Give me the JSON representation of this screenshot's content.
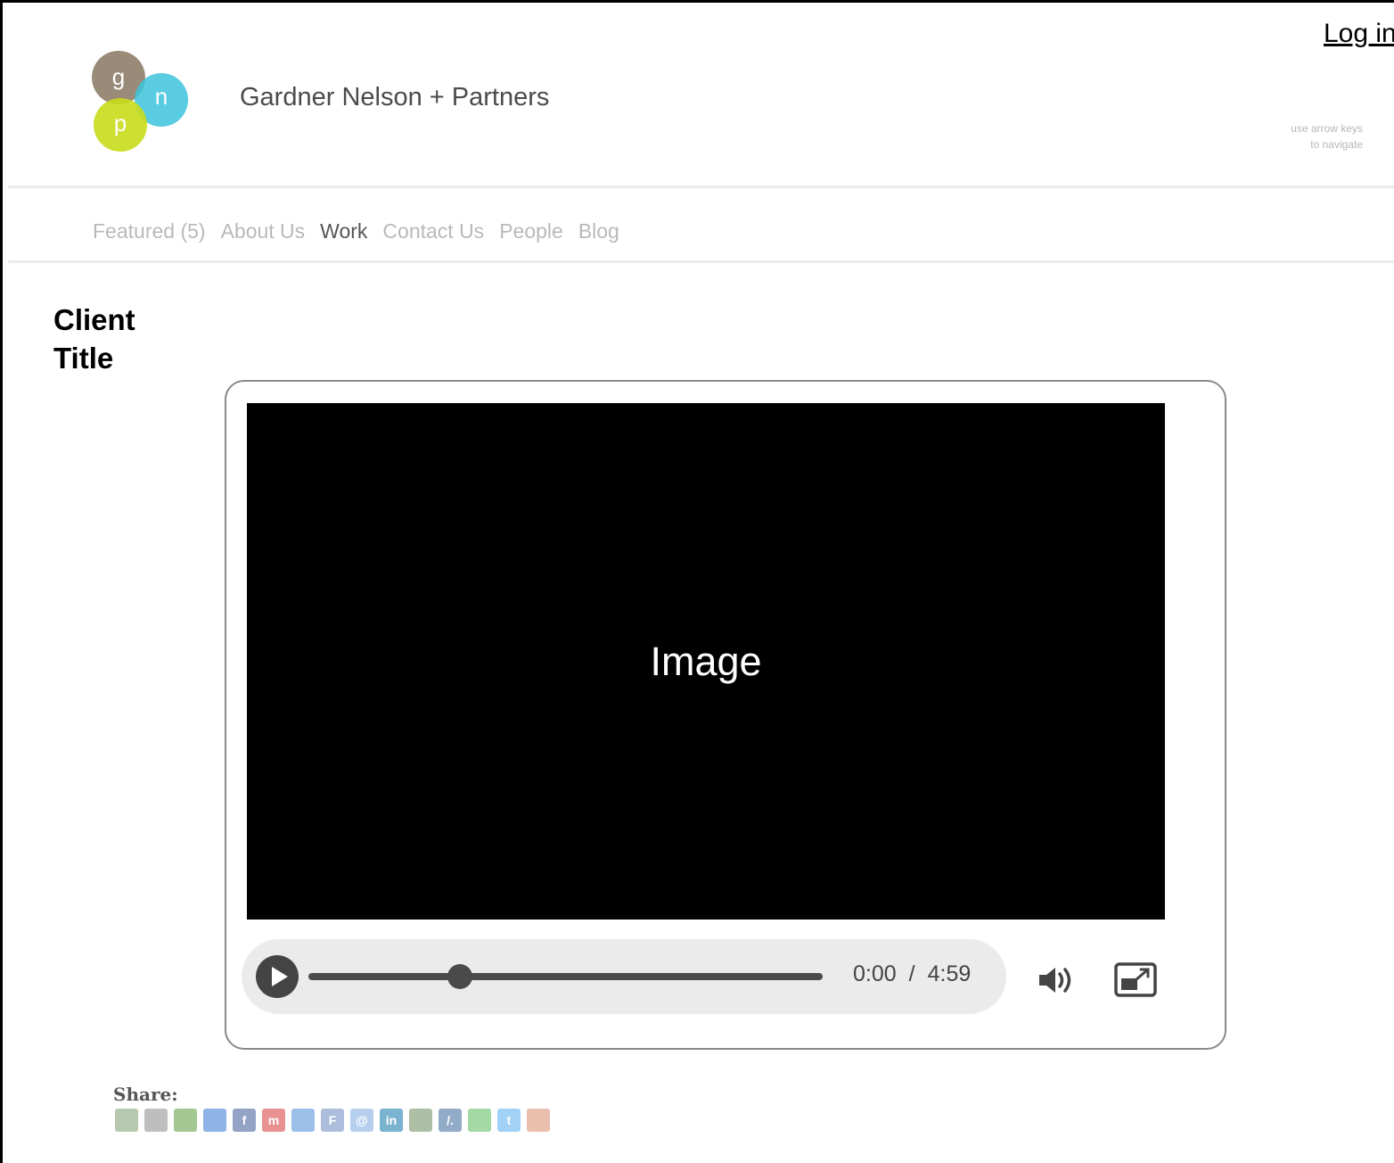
{
  "header": {
    "login_label": "Log in",
    "brand_name": "Gardner Nelson + Partners",
    "logo_letters": [
      "g",
      "n",
      "p"
    ],
    "hint_line1": "use arrow keys",
    "hint_line2": "to navigate"
  },
  "nav": {
    "items": [
      {
        "label": "Featured (5)",
        "active": false
      },
      {
        "label": "About Us",
        "active": false
      },
      {
        "label": "Work",
        "active": true
      },
      {
        "label": "Contact Us",
        "active": false
      },
      {
        "label": "People",
        "active": false
      },
      {
        "label": "Blog",
        "active": false
      }
    ]
  },
  "main": {
    "client_title_line1": "Client",
    "client_title_line2": "Title"
  },
  "player": {
    "image_placeholder": "Image",
    "current_time": "0:00",
    "time_separator": "/",
    "duration": "4:59",
    "progress_fraction": 0.295
  },
  "share": {
    "label": "Share:",
    "icons": [
      {
        "name": "digg-icon",
        "color": "#7a9a6a",
        "glyph": ""
      },
      {
        "name": "myspace-icon",
        "color": "#888888",
        "glyph": ""
      },
      {
        "name": "newsvine-icon",
        "color": "#5a9a3a",
        "glyph": ""
      },
      {
        "name": "delicious-icon",
        "color": "#3274d0",
        "glyph": ""
      },
      {
        "name": "facebook-icon",
        "color": "#3b5998",
        "glyph": "f"
      },
      {
        "name": "mixx-icon",
        "color": "#d63a3a",
        "glyph": "m"
      },
      {
        "name": "google-icon",
        "color": "#4a8ad8",
        "glyph": ""
      },
      {
        "name": "friendfeed-icon",
        "color": "#6a8ac0",
        "glyph": "F"
      },
      {
        "name": "email-icon",
        "color": "#7aa8e0",
        "glyph": "@"
      },
      {
        "name": "linkedin-icon",
        "color": "#0e76a8",
        "glyph": "in"
      },
      {
        "name": "yahoo-buzz-icon",
        "color": "#6a8a5a",
        "glyph": ""
      },
      {
        "name": "tipd-icon",
        "color": "#3a6a9a",
        "glyph": "/."
      },
      {
        "name": "slashdot-icon",
        "color": "#5ab85a",
        "glyph": ""
      },
      {
        "name": "twitter-icon",
        "color": "#55acee",
        "glyph": "t"
      },
      {
        "name": "reddit-icon",
        "color": "#d88a6a",
        "glyph": ""
      }
    ]
  }
}
